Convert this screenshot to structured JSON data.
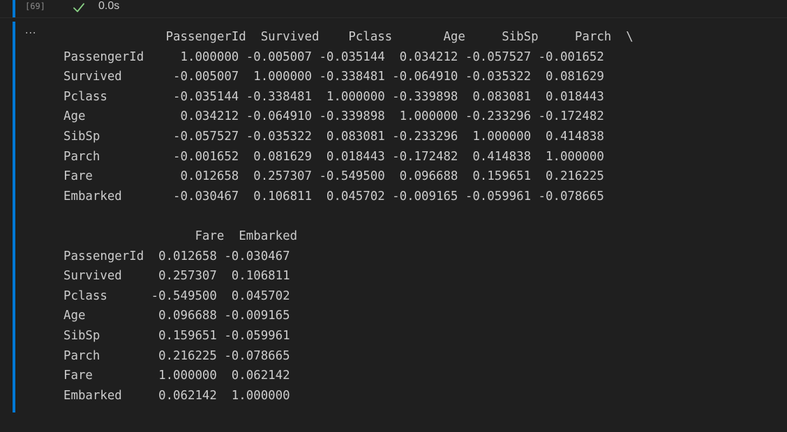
{
  "cell": {
    "execution_count": "[69]",
    "status_icon": "check-icon",
    "exec_time": "0.0s",
    "output_menu_label": "···"
  },
  "colors": {
    "background": "#1f1f1f",
    "accent": "#0078d4",
    "success": "#89d185",
    "text": "#cccccc",
    "muted": "#8a8a8a"
  },
  "output": {
    "block1": {
      "header": "              PassengerId  Survived    Pclass       Age     SibSp     Parch  \\",
      "rows": [
        "PassengerId     1.000000 -0.005007 -0.035144  0.034212 -0.057527 -0.001652",
        "Survived       -0.005007  1.000000 -0.338481 -0.064910 -0.035322  0.081629",
        "Pclass         -0.035144 -0.338481  1.000000 -0.339898  0.083081  0.018443",
        "Age             0.034212 -0.064910 -0.339898  1.000000 -0.233296 -0.172482",
        "SibSp          -0.057527 -0.035322  0.083081 -0.233296  1.000000  0.414838",
        "Parch          -0.001652  0.081629  0.018443 -0.172482  0.414838  1.000000",
        "Fare            0.012658  0.257307 -0.549500  0.096688  0.159651  0.216225",
        "Embarked       -0.030467  0.106811  0.045702 -0.009165 -0.059961 -0.078665"
      ]
    },
    "block2": {
      "header": "                  Fare  Embarked",
      "rows": [
        "PassengerId  0.012658 -0.030467",
        "Survived     0.257307  0.106811",
        "Pclass      -0.549500  0.045702",
        "Age          0.096688 -0.009165",
        "SibSp        0.159651 -0.059961",
        "Parch        0.216225 -0.078665",
        "Fare         1.000000  0.062142",
        "Embarked     0.062142  1.000000"
      ]
    }
  }
}
